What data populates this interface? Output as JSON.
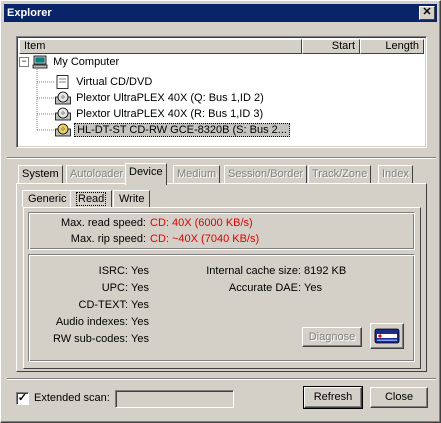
{
  "window": {
    "title": "Explorer",
    "close_glyph": "✕"
  },
  "tree": {
    "columns": [
      "Item",
      "Start",
      "Length"
    ],
    "root": {
      "expander": "⊟",
      "label": "My Computer"
    },
    "items": [
      {
        "label": "Virtual CD/DVD",
        "icon": "cd-drive-icon"
      },
      {
        "label": "Plextor UltraPLEX 40X (Q: Bus 1,ID 2)",
        "icon": "cd-drive-icon"
      },
      {
        "label": "Plextor UltraPLEX 40X (R: Bus 1,ID 3)",
        "icon": "cd-drive-icon"
      },
      {
        "label": "HL-DT-ST CD-RW GCE-8320B (S: Bus 2...",
        "icon": "cd-drive-icon",
        "selected": true
      }
    ]
  },
  "tabs": [
    {
      "label": "System",
      "disabled": false
    },
    {
      "label": "Autoloader",
      "disabled": true
    },
    {
      "label": "Device",
      "disabled": false,
      "active": true
    },
    {
      "label": "Medium",
      "disabled": true
    },
    {
      "label": "Session/Border",
      "disabled": true
    },
    {
      "label": "Track/Zone",
      "disabled": true
    },
    {
      "label": "Index",
      "disabled": true
    }
  ],
  "subtabs": [
    {
      "label": "Generic"
    },
    {
      "label": "Read",
      "active": true
    },
    {
      "label": "Write"
    }
  ],
  "speeds": {
    "max_read_label": "Max. read speed:",
    "max_read_value": "CD: 40X (6000 KB/s)",
    "max_rip_label": "Max. rip speed:",
    "max_rip_value": "CD: ~40X (7040 KB/s)"
  },
  "features": [
    {
      "label": "ISRC:",
      "value": "Yes"
    },
    {
      "label": "UPC:",
      "value": "Yes"
    },
    {
      "label": "CD-TEXT:",
      "value": "Yes"
    },
    {
      "label": "Audio indexes:",
      "value": "Yes"
    },
    {
      "label": "RW sub-codes:",
      "value": "Yes"
    }
  ],
  "cache": {
    "label": "Internal cache size:",
    "value": "8192 KB"
  },
  "dae": {
    "label": "Accurate DAE:",
    "value": "Yes"
  },
  "diagnose_label": "Diagnose",
  "footer": {
    "extended_scan_label": "Extended scan:",
    "extended_scan_checked": true,
    "check_glyph": "✓",
    "refresh_label": "Refresh",
    "close_label": "Close"
  },
  "colors": {
    "accent": "#0a246a",
    "value_red": "#e00000"
  }
}
